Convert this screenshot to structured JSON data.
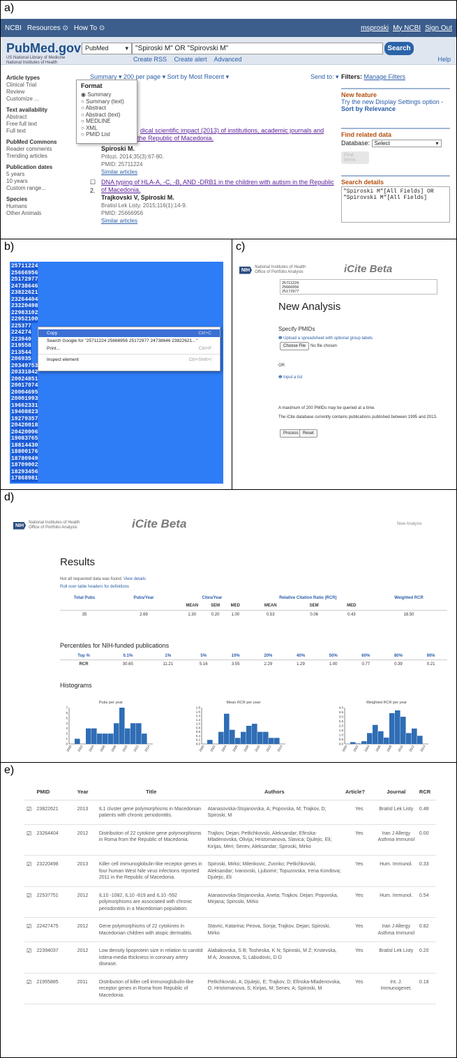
{
  "panels": {
    "a": "a)",
    "b": "b)",
    "c": "c)",
    "d": "d)",
    "e": "e)"
  },
  "ncbi": {
    "brand": "NCBI",
    "resources": "Resources ⊙",
    "howto": "How To ⊙",
    "user": "msproski",
    "myncbi": "My NCBI",
    "signout": "Sign Out",
    "logo": "PubMed.gov",
    "logo_sub": "US National Library of Medicine\nNational Institutes of Health",
    "db": "PubMed",
    "query": "\"Spiroski M\" OR \"Spirovski M\"",
    "search_btn": "Search",
    "links": [
      "Create RSS",
      "Create alert",
      "Advanced"
    ],
    "help": "Help",
    "sidebar": [
      {
        "h": "Article types",
        "items": [
          "Clinical Trial",
          "Review",
          "Customize ..."
        ]
      },
      {
        "h": "Text availability",
        "items": [
          "Abstract",
          "Free full text",
          "Full text"
        ]
      },
      {
        "h": "PubMed Commons",
        "items": [
          "Reader comments",
          "Trending articles"
        ]
      },
      {
        "h": "Publication dates",
        "items": [
          "5 years",
          "10 years",
          "Custom range..."
        ]
      },
      {
        "h": "Species",
        "items": [
          "Humans",
          "Other Animals"
        ]
      }
    ],
    "summary_bar": "Summary ▾   200 per page ▾   Sort by Most Recent ▾",
    "sendto": "Send to: ▾",
    "format": {
      "title": "Format",
      "options": [
        "Summary",
        "Summary (text)",
        "Abstract",
        "Abstract (text)",
        "MEDLINE",
        "XML",
        "PMID List"
      ]
    },
    "r1": {
      "title_a": "dical scientific impact (2013) of institutions, academic journals and",
      "title_b": "the Republic of Macedonia.",
      "author": "Spiroski M.",
      "journal": "Prilozi. 2014;35(3):67-80.",
      "pmid": "PMID: 25711224",
      "similar": "Similar articles"
    },
    "r2": {
      "num": "2.",
      "title": "DNA typing of HLA-A, -C, -B, AND -DRB1 in the children with autism in the Republic of Macedonia.",
      "author": "Trajkovski V, Spiroski M.",
      "journal": "Bratisl Lek Listy. 2015;116(1):14-9.",
      "pmid": "PMID: 25666956",
      "similar": "Similar articles"
    },
    "filters": {
      "label": "Filters:",
      "manage": "Manage Filters"
    },
    "newfeat": {
      "h": "New feature",
      "t": "Try the new Display Settings option -",
      "b": "Sort by Relevance"
    },
    "related": {
      "h": "Find related data",
      "db_label": "Database:",
      "db_val": "Select",
      "btn": "Find items"
    },
    "details": {
      "h": "Search details",
      "text": "\"Spiroski M\"[All Fields] OR\n\"Spirovski M\"[All Fields]"
    }
  },
  "pmids": [
    "25711224",
    "25666956",
    "25172977",
    "24738646",
    "23822621",
    "23264404",
    "23220498",
    "22983102",
    "22952100",
    "225377",
    "224274",
    "223940",
    "219558",
    "213544",
    "206935",
    "20349753",
    "20331842",
    "20024851",
    "20017074",
    "20004695",
    "20001993",
    "19662331",
    "19408823",
    "19279357",
    "20420018",
    "20420006",
    "19083765",
    "18814430",
    "18800176",
    "18780949",
    "18709002",
    "18293456",
    "17868981"
  ],
  "ctxmenu": [
    {
      "label": "Copy",
      "key": "Ctrl+C"
    },
    {
      "label": "Search Google for \"25711224 25666956 25172977 24738646 23822621...\"",
      "key": ""
    },
    {
      "label": "Print...",
      "key": "Ctrl+P"
    },
    {
      "label": "Inspect element",
      "key": "Ctrl+Shift+I"
    }
  ],
  "icite": {
    "nih_logo": "NIH",
    "nih_name": "National Institutes of Health",
    "nih_office": "Office of Portfolio Analysis",
    "title": "iCite Beta",
    "new_analysis": "New Analysis",
    "specify": "Specify PMIDs",
    "upload": "❶ Upload a spreadsheet with optional group labels",
    "choose": "Choose File",
    "nofile": "No file chosen",
    "or": "OR",
    "input": "❶ Input a list",
    "ta": "25711224\n25666956\n25172977",
    "max": "A maximum of 200 PMIDs may be queried at a time.",
    "db_note": "The iCite database currently contains publications published between 1995 and 2013.",
    "process": "Process",
    "reset": "Reset",
    "nav_new": "New Analysis"
  },
  "results": {
    "title": "Results",
    "notall": "Not all requested data was found.",
    "view": "View details",
    "rollover": "Roll over table headers for definitions",
    "headers": [
      "Total Pubs",
      "Pubs/Year",
      "Cites/Year",
      "Relative Citation Ratio (RCR)",
      "Weighted RCR"
    ],
    "sub": [
      "MEAN",
      "SEM",
      "MED",
      "MEAN",
      "SEM",
      "MED"
    ],
    "values": [
      "35",
      "2.69",
      "1.30",
      "0.20",
      "1.00",
      "0.53",
      "0.06",
      "0.43",
      "18.50"
    ],
    "pct_title": "Percentiles for NIH-funded publications",
    "pct_headers": [
      "Top %",
      "0.1%",
      "1%",
      "5%",
      "10%",
      "20%",
      "40%",
      "50%",
      "60%",
      "80%",
      "90%"
    ],
    "pct_values": [
      "RCR",
      "30.65",
      "11.21",
      "5.16",
      "3.55",
      "2.29",
      "1.29",
      "1.00",
      "0.77",
      "0.39",
      "0.21"
    ],
    "hist_title": "Histograms",
    "x_labels": [
      "2000",
      "2002",
      "2004",
      "2006",
      "2008",
      "2010",
      "2012",
      "2014"
    ]
  },
  "chart_data": [
    {
      "type": "bar",
      "title": "Pubs per year",
      "ylim": [
        0,
        7
      ],
      "y_ticks": [
        "7",
        "6",
        "5",
        "4",
        "3",
        "2",
        "1",
        "0"
      ],
      "x": [
        2001,
        2003,
        2004,
        2005,
        2006,
        2007,
        2008,
        2009,
        2010,
        2011,
        2012,
        2013
      ],
      "values": [
        1,
        3,
        3,
        2,
        2,
        2,
        4,
        7,
        3,
        4,
        4,
        2
      ]
    },
    {
      "type": "bar",
      "title": "Mean RCR per year",
      "ylim": [
        0,
        1.8
      ],
      "y_ticks": [
        "1.8",
        "1.6",
        "1.4",
        "1.2",
        "1.0",
        "0.8",
        "0.6",
        "0.4",
        "0.2",
        "0.0"
      ],
      "x": [
        2001,
        2003,
        2004,
        2005,
        2006,
        2007,
        2008,
        2009,
        2010,
        2011,
        2012,
        2013
      ],
      "values": [
        0.2,
        0.6,
        1.5,
        0.7,
        0.3,
        0.6,
        0.9,
        1.0,
        0.6,
        0.6,
        0.3,
        0.3
      ]
    },
    {
      "type": "bar",
      "title": "Weighted RCR per year",
      "ylim": [
        0,
        4
      ],
      "y_ticks": [
        "4.0",
        "3.5",
        "3.0",
        "2.5",
        "2.0",
        "1.5",
        "1.0",
        "0.5",
        "0.0"
      ],
      "x": [
        2001,
        2002,
        2003,
        2004,
        2005,
        2006,
        2007,
        2008,
        2009,
        2010,
        2011,
        2012,
        2013
      ],
      "values": [
        0.2,
        0.05,
        0.3,
        1.2,
        2.1,
        1.4,
        0.7,
        3.4,
        3.7,
        3.0,
        1.2,
        1.7,
        0.9
      ]
    }
  ],
  "table": {
    "headers": [
      "PMID",
      "Year",
      "Title",
      "Authors",
      "Article?",
      "Journal",
      "RCR"
    ],
    "rows": [
      [
        "23822621",
        "2013",
        "IL1 cluster gene polymorphisms in Macedonian patients with chronic periodontitis.",
        "Atanasovska-Stojanovska, A; Popovska, M; Trajkov, D; Spiroski, M",
        "Yes",
        "Bratisl Lek Listy",
        "0.48"
      ],
      [
        "23264404",
        "2012",
        "Distribution of 22 cytokine gene polymorphisms in Roma from the Republic of Macedonia.",
        "Trajkov, Dejan; Petlichkovski, Aleksandar; Efinska-Mladenovska, Olivija; Hristomanova, Slavica; Djulejic, Eli; Kirijas, Meri; Senev, Aleksandar; Spiroski, Mirko",
        "Yes",
        "Iran J Allergy Asthma Immunol",
        "0.00"
      ],
      [
        "23220498",
        "2013",
        "Killer cell immunoglobulin-like receptor genes in four human West Nile virus infections reported 2011 in the Republic of Macedonia.",
        "Spiroski, Mirko; Milenkovic, Zvonko; Petlichkovski, Aleksandar; Ivanovski, Ljubomir; Topuzovska, Irena Kondova; Djulejic, Eli",
        "Yes",
        "Hum. Immunol.",
        "0.33"
      ],
      [
        "22537751",
        "2012",
        "IL10 -1082, IL10 -819 and IL10 -592 polymorphisms are associated with chronic periodontitis in a Macedonian population.",
        "Atanasovska-Stojanovska, Aneta; Trajkov, Dejan; Popovska, Mirjana; Spiroski, Mirko",
        "Yes",
        "Hum. Immunol.",
        "0.54"
      ],
      [
        "22427475",
        "2012",
        "Gene polymorphisms of 22 cytokines in Macedonian children with atopic dermatitis.",
        "Stavric, Katarina; Peova, Sonja; Trajkov, Dejan; Spiroski, Mirko",
        "Yes",
        "Iran J Allergy Asthma Immunol",
        "0.82"
      ],
      [
        "22394037",
        "2012",
        "Low density lipoprotein size in relation to carotid intima-media thickness in coronary artery disease.",
        "Alabakovska, S B; Tosheska, K N; Spiroski, M Z; Krstevska, M A; Jovanova, S; Labudovic, D D",
        "Yes",
        "Bratisl Lek Listy",
        "0.20"
      ],
      [
        "21955885",
        "2011",
        "Distribution of killer cell immunoglobulin-like receptor genes in Roma from Republic of Macedonia.",
        "Petlichkovski, A; Djulejic, E; Trajkov, D; Efinska-Mladenovska, O; Hristomanova, S; Kirijas, M; Senev, A; Spiroski, M",
        "Yes",
        "Int. J. Immunogenet.",
        "0.18"
      ]
    ]
  }
}
